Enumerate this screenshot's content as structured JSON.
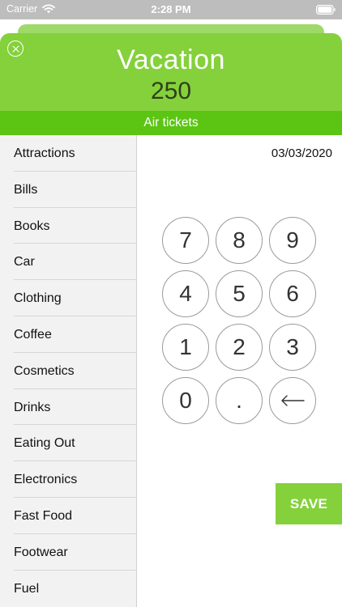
{
  "status_bar": {
    "carrier": "Carrier",
    "time": "2:28 PM",
    "wifi_icon": "wifi-icon",
    "battery_icon": "battery-icon"
  },
  "header": {
    "close_icon": "close-icon",
    "title": "Vacation",
    "amount": "250",
    "subtitle": "Air tickets",
    "colors": {
      "header": "#84d13b",
      "subheader": "#5cc514",
      "amount_text": "#2f3f1c"
    }
  },
  "categories": [
    "Attractions",
    "Bills",
    "Books",
    "Car",
    "Clothing",
    "Coffee",
    "Cosmetics",
    "Drinks",
    "Eating Out",
    "Electronics",
    "Fast Food",
    "Footwear",
    "Fuel"
  ],
  "date": "03/03/2020",
  "keypad": {
    "keys": [
      "7",
      "8",
      "9",
      "4",
      "5",
      "6",
      "1",
      "2",
      "3",
      "0",
      ".",
      ""
    ],
    "backspace_icon": "backspace-arrow-icon"
  },
  "save": {
    "label": "SAVE",
    "color": "#84d13b"
  }
}
